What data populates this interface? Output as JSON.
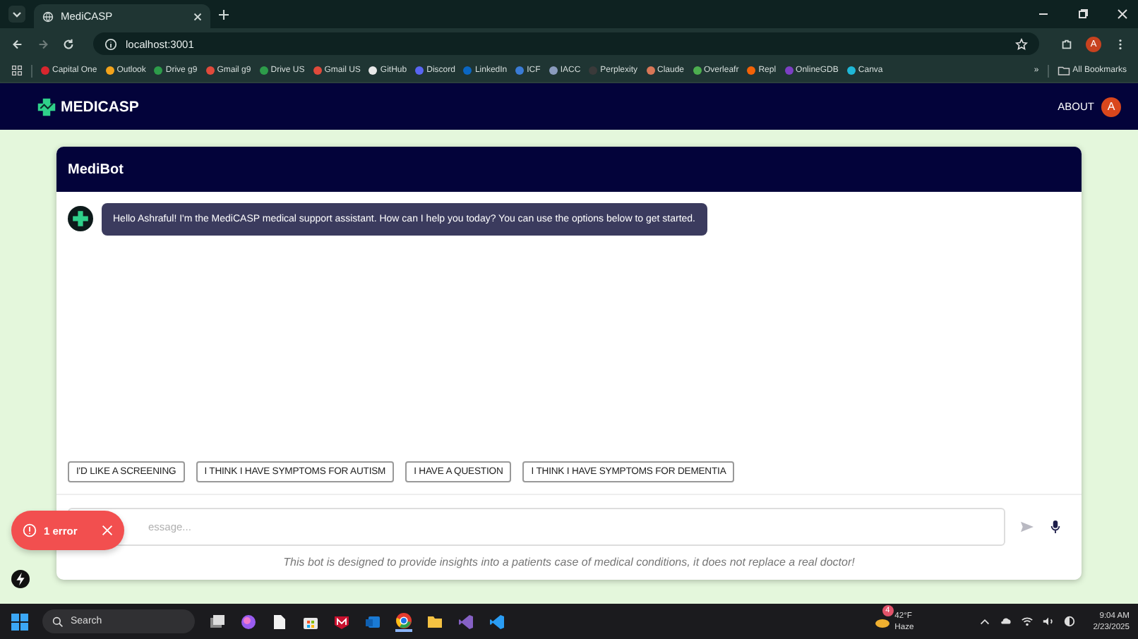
{
  "browser": {
    "tab_title": "MediCASP",
    "address": "localhost:3001",
    "profile_initial": "A",
    "bookmarks": [
      {
        "label": "Capital One",
        "color": "#d8262e"
      },
      {
        "label": "Outlook",
        "color": "#f2a31b"
      },
      {
        "label": "Drive g9",
        "color": "#2d9c4a"
      },
      {
        "label": "Gmail g9",
        "color": "#e04a3b"
      },
      {
        "label": "Drive US",
        "color": "#2d9c4a"
      },
      {
        "label": "Gmail US",
        "color": "#e04a3b"
      },
      {
        "label": "GitHub",
        "color": "#e8e8e8"
      },
      {
        "label": "Discord",
        "color": "#5865f2"
      },
      {
        "label": "LinkedIn",
        "color": "#0a66c2"
      },
      {
        "label": "ICF",
        "color": "#3a7bd5"
      },
      {
        "label": "IACC",
        "color": "#8a9bbd"
      },
      {
        "label": "Perplexity",
        "color": "#3a3a3a"
      },
      {
        "label": "Claude",
        "color": "#d97757"
      },
      {
        "label": "Overleafr",
        "color": "#4cae4f"
      },
      {
        "label": "Repl",
        "color": "#f26207"
      },
      {
        "label": "OnlineGDB",
        "color": "#7b3fc4"
      },
      {
        "label": "Canva",
        "color": "#1fb7d6"
      }
    ],
    "more": "»",
    "all_bookmarks": "All Bookmarks"
  },
  "app": {
    "brand": "MEDICASP",
    "about": "ABOUT",
    "avatar_initial": "A"
  },
  "chat": {
    "title": "MediBot",
    "messages": [
      {
        "text": "Hello Ashraful! I'm the MediCASP medical support assistant. How can I help you today? You can use the options below to get started."
      }
    ],
    "options": [
      "I'D LIKE A SCREENING",
      "I THINK I HAVE SYMPTOMS FOR AUTISM",
      "I HAVE A QUESTION",
      "I THINK I HAVE SYMPTOMS FOR DEMENTIA"
    ],
    "input": {
      "placeholder": "essage..."
    },
    "disclaimer": "This bot is designed to provide insights into a patients case of medical conditions, it does not replace a real doctor!"
  },
  "error_toast": {
    "label": "1 error"
  },
  "taskbar": {
    "search_placeholder": "Search",
    "weather_badge": "4",
    "temperature": "42°F",
    "condition": "Haze",
    "time": "9:04 AM",
    "date": "2/23/2025"
  }
}
